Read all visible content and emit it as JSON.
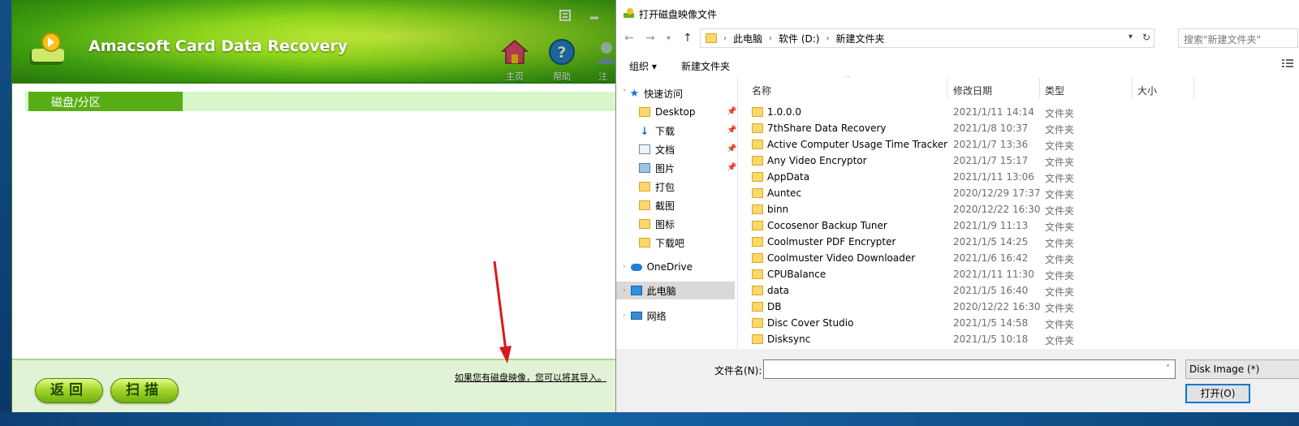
{
  "app": {
    "title": "Amacsoft Card Data Recovery",
    "toolbar": [
      {
        "label": "主页",
        "icon": "home-icon"
      },
      {
        "label": "帮助",
        "icon": "help-icon"
      },
      {
        "label": "注",
        "icon": "register-icon"
      }
    ],
    "tab": "磁盘/分区",
    "hint": "如果您有磁盘映像，您可以将其导入。",
    "back_label": "返回",
    "scan_label": "扫描",
    "colors": {
      "accent": "#58ad14",
      "header": "#8fd51d"
    }
  },
  "dialog": {
    "title": "打开磁盘映像文件",
    "breadcrumb": [
      "此电脑",
      "软件 (D:)",
      "新建文件夹"
    ],
    "search_placeholder": "搜索\"新建文件夹\"",
    "organize_label": "组织 ▾",
    "new_folder_label": "新建文件夹",
    "nav": {
      "quick_access": "快速访问",
      "quick_items": [
        "Desktop",
        "下载",
        "文档",
        "图片",
        "打包",
        "截图",
        "图标",
        "下载吧"
      ],
      "onedrive": "OneDrive",
      "this_pc": "此电脑",
      "network": "网络"
    },
    "columns": [
      "名称",
      "修改日期",
      "类型",
      "大小"
    ],
    "files": [
      {
        "name": "1.0.0.0",
        "date": "2021/1/11 14:14",
        "type": "文件夹"
      },
      {
        "name": "7thShare Data Recovery",
        "date": "2021/1/8 10:37",
        "type": "文件夹"
      },
      {
        "name": "Active Computer Usage Time Tracker",
        "date": "2021/1/7 13:36",
        "type": "文件夹"
      },
      {
        "name": "Any Video Encryptor",
        "date": "2021/1/7 15:17",
        "type": "文件夹"
      },
      {
        "name": "AppData",
        "date": "2021/1/11 13:06",
        "type": "文件夹"
      },
      {
        "name": "Auntec",
        "date": "2020/12/29 17:37",
        "type": "文件夹"
      },
      {
        "name": "binn",
        "date": "2020/12/22 16:30",
        "type": "文件夹"
      },
      {
        "name": "Cocosenor Backup Tuner",
        "date": "2021/1/9 11:13",
        "type": "文件夹"
      },
      {
        "name": "Coolmuster PDF Encrypter",
        "date": "2021/1/5 14:25",
        "type": "文件夹"
      },
      {
        "name": "Coolmuster Video Downloader",
        "date": "2021/1/6 16:42",
        "type": "文件夹"
      },
      {
        "name": "CPUBalance",
        "date": "2021/1/11 11:30",
        "type": "文件夹"
      },
      {
        "name": "data",
        "date": "2021/1/5 16:40",
        "type": "文件夹"
      },
      {
        "name": "DB",
        "date": "2020/12/22 16:30",
        "type": "文件夹"
      },
      {
        "name": "Disc Cover Studio",
        "date": "2021/1/5 14:58",
        "type": "文件夹"
      },
      {
        "name": "Disksync",
        "date": "2021/1/5 10:18",
        "type": "文件夹"
      }
    ],
    "filename_label": "文件名(N):",
    "filename_value": "",
    "filetype_value": "Disk Image (*)",
    "open_label": "打开(O)"
  }
}
